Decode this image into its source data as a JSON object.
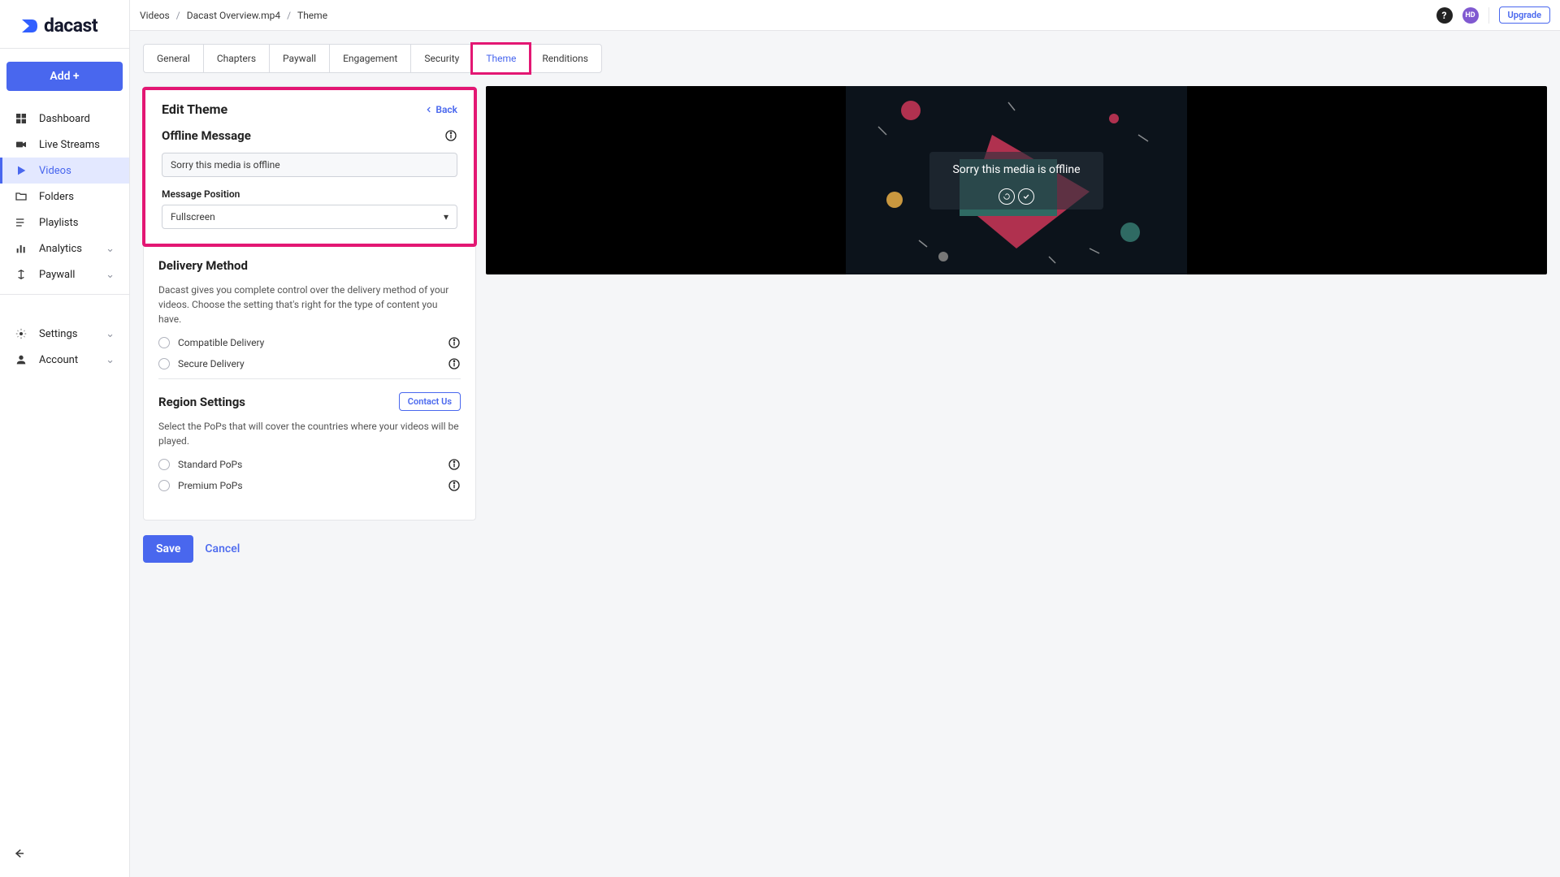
{
  "brand": "dacast",
  "add_button": "Add +",
  "sidebar": {
    "items": [
      {
        "label": "Dashboard"
      },
      {
        "label": "Live Streams"
      },
      {
        "label": "Videos"
      },
      {
        "label": "Folders"
      },
      {
        "label": "Playlists"
      },
      {
        "label": "Analytics"
      },
      {
        "label": "Paywall"
      },
      {
        "label": "Settings"
      },
      {
        "label": "Account"
      }
    ]
  },
  "breadcrumb": [
    "Videos",
    "Dacast Overview.mp4",
    "Theme"
  ],
  "avatar_initials": "HD",
  "upgrade_label": "Upgrade",
  "tabs": [
    "General",
    "Chapters",
    "Paywall",
    "Engagement",
    "Security",
    "Theme",
    "Renditions"
  ],
  "panel": {
    "title": "Edit Theme",
    "back": "Back",
    "offline_title": "Offline Message",
    "offline_input": "Sorry this media is offline",
    "position_label": "Message Position",
    "position_value": "Fullscreen",
    "delivery_title": "Delivery Method",
    "delivery_desc": "Dacast gives you complete control over the delivery method of your videos. Choose the setting that's right for the type of content you have.",
    "delivery_opt1": "Compatible Delivery",
    "delivery_opt2": "Secure Delivery",
    "region_title": "Region Settings",
    "contact_label": "Contact Us",
    "region_desc": "Select the PoPs that will cover the countries where your videos will be played.",
    "region_opt1": "Standard PoPs",
    "region_opt2": "Premium PoPs"
  },
  "actions": {
    "save": "Save",
    "cancel": "Cancel"
  },
  "preview_message": "Sorry this media is offline"
}
